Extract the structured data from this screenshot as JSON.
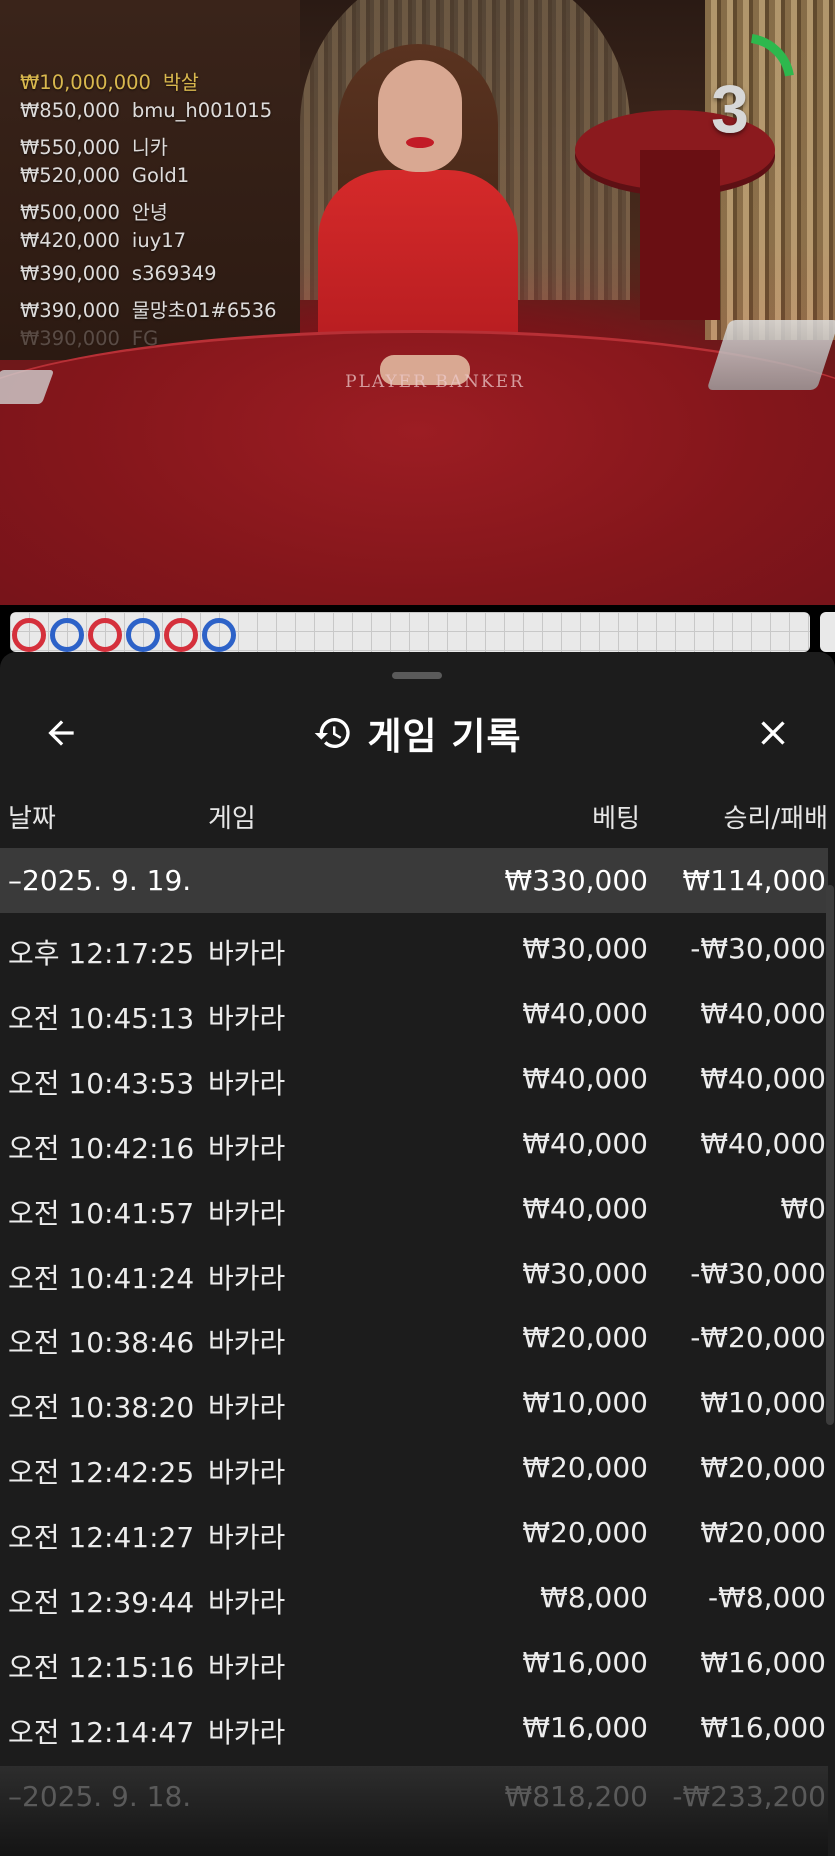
{
  "leaderboard": [
    {
      "amount": "₩10,000,000",
      "name": "박살"
    },
    {
      "amount": "₩850,000",
      "name": "bmu_h001015"
    },
    {
      "amount": "₩550,000",
      "name": "니카"
    },
    {
      "amount": "₩520,000",
      "name": "Gold1"
    },
    {
      "amount": "₩500,000",
      "name": "안녕"
    },
    {
      "amount": "₩420,000",
      "name": "iuy17"
    },
    {
      "amount": "₩390,000",
      "name": "s369349"
    },
    {
      "amount": "₩390,000",
      "name": "물망초01#6536"
    },
    {
      "amount": "₩390,000",
      "name": "FG"
    }
  ],
  "timer": {
    "value": "3",
    "progress_fraction": 0.2,
    "color": "#2db84d"
  },
  "table_felt": {
    "text": "PLAYER       BANKER"
  },
  "beads": [
    {
      "color": "#d5303c"
    },
    {
      "color": "#2d62c8"
    },
    {
      "color": "#d5303c"
    },
    {
      "color": "#2d62c8"
    },
    {
      "color": "#d5303c"
    },
    {
      "color": "#2d62c8"
    }
  ],
  "sheet": {
    "title": "게임 기록",
    "columns": {
      "date": "날짜",
      "game": "게임",
      "bet": "베팅",
      "result": "승리/패배"
    },
    "group_current": {
      "date": "–2025. 9. 19.",
      "bet": "₩330,000",
      "result": "₩114,000"
    },
    "rows": [
      {
        "time": "오후 12:17:25",
        "game": "바카라",
        "bet": "₩30,000",
        "result": "-₩30,000"
      },
      {
        "time": "오전 10:45:13",
        "game": "바카라",
        "bet": "₩40,000",
        "result": "₩40,000"
      },
      {
        "time": "오전 10:43:53",
        "game": "바카라",
        "bet": "₩40,000",
        "result": "₩40,000"
      },
      {
        "time": "오전 10:42:16",
        "game": "바카라",
        "bet": "₩40,000",
        "result": "₩40,000"
      },
      {
        "time": "오전 10:41:57",
        "game": "바카라",
        "bet": "₩40,000",
        "result": "₩0"
      },
      {
        "time": "오전 10:41:24",
        "game": "바카라",
        "bet": "₩30,000",
        "result": "-₩30,000"
      },
      {
        "time": "오전 10:38:46",
        "game": "바카라",
        "bet": "₩20,000",
        "result": "-₩20,000"
      },
      {
        "time": "오전 10:38:20",
        "game": "바카라",
        "bet": "₩10,000",
        "result": "₩10,000"
      },
      {
        "time": "오전 12:42:25",
        "game": "바카라",
        "bet": "₩20,000",
        "result": "₩20,000"
      },
      {
        "time": "오전 12:41:27",
        "game": "바카라",
        "bet": "₩20,000",
        "result": "₩20,000"
      },
      {
        "time": "오전 12:39:44",
        "game": "바카라",
        "bet": "₩8,000",
        "result": "-₩8,000"
      },
      {
        "time": "오전 12:15:16",
        "game": "바카라",
        "bet": "₩16,000",
        "result": "₩16,000"
      },
      {
        "time": "오전 12:14:47",
        "game": "바카라",
        "bet": "₩16,000",
        "result": "₩16,000"
      }
    ],
    "group_next": {
      "date": "–2025. 9. 18.",
      "bet": "₩818,200",
      "result": "-₩233,200"
    }
  },
  "icons": {
    "back": "arrow-left-icon",
    "history": "history-icon",
    "close": "close-icon"
  }
}
